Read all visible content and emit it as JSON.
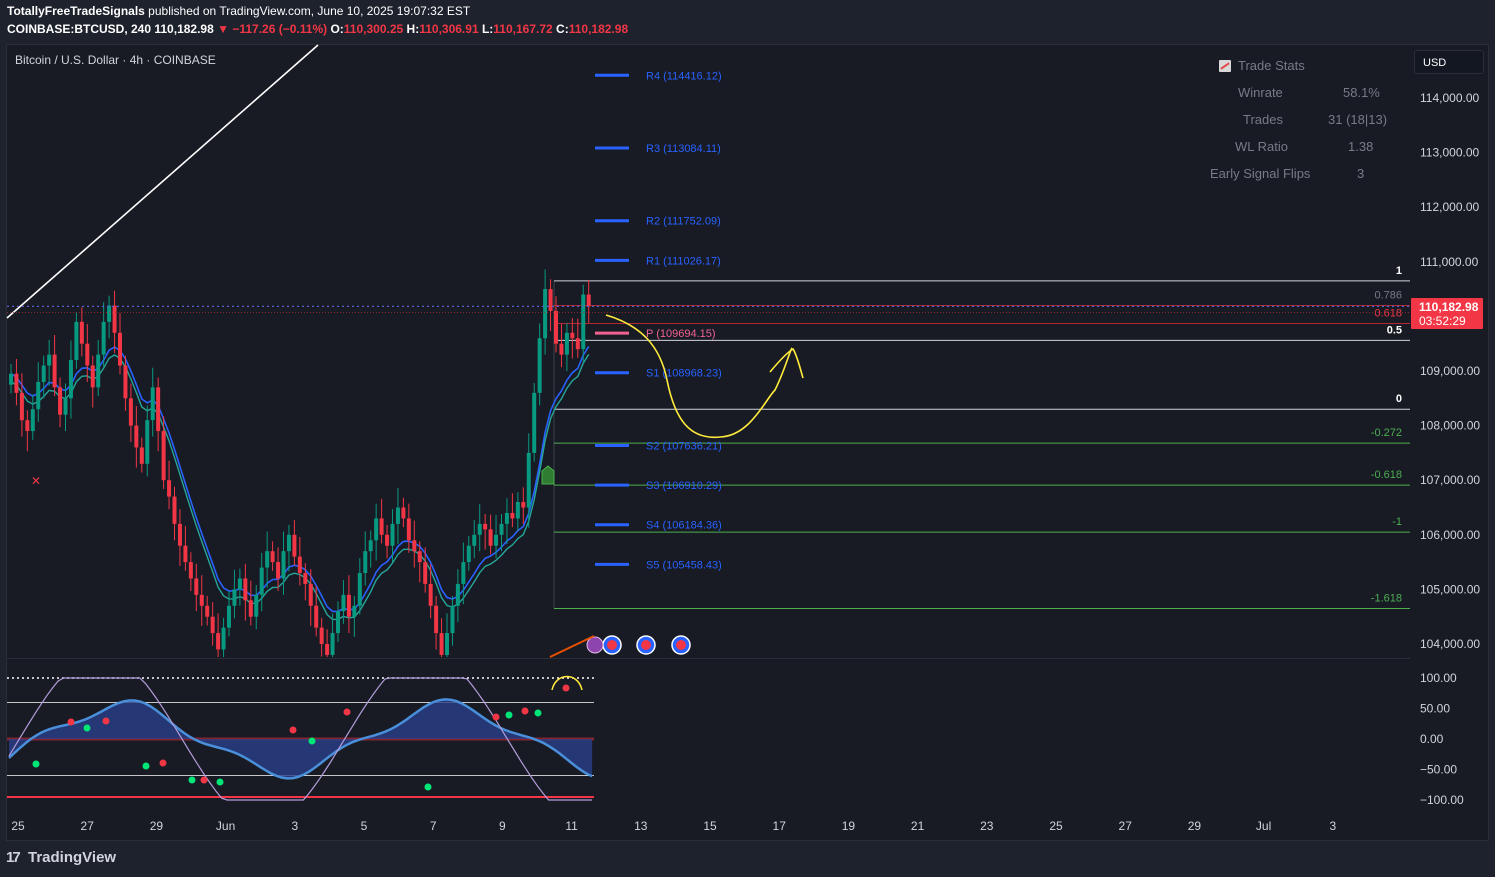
{
  "header": {
    "author": "TotallyFreeTradeSignals",
    "published_text": "published on TradingView.com, June 10, 2025 19:07:32 EST",
    "symbol_line": "COINBASE:BTCUSD, 240",
    "last": "110,182.98",
    "change_arrow": "▼",
    "change": "−117.26 (−0.11%)",
    "o_label": "O:",
    "o": "110,300.25",
    "h_label": "H:",
    "h": "110,306.91",
    "l_label": "L:",
    "l": "110,167.72",
    "c_label": "C:",
    "c": "110,182.98"
  },
  "symbol_title": "Bitcoin / U.S. Dollar · 4h · COINBASE",
  "currency_button": "USD",
  "price_tag": {
    "price": "110,182.98",
    "countdown": "03:52:29"
  },
  "trade_stats": {
    "title": "Trade Stats",
    "rows": [
      {
        "label": "Winrate",
        "value": "58.1%"
      },
      {
        "label": "Trades",
        "value": "31 (18|13)"
      },
      {
        "label": "WL Ratio",
        "value": "1.38"
      },
      {
        "label": "Early Signal Flips",
        "value": "3"
      }
    ]
  },
  "footer": {
    "logo_text": "TradingView",
    "logo_mark": "17"
  },
  "colors": {
    "background": "#181b24",
    "up": "#089981",
    "down": "#f23645",
    "pivot_blue": "#2962ff",
    "pivot_pink": "#f06292",
    "fib_green": "#4caf50",
    "annotation_yellow": "#ffeb3b",
    "ema_blue": "#2962ff",
    "ema_red": "#b22833",
    "ema_teal": "#26a69a"
  },
  "chart_data": [
    {
      "type": "candlestick",
      "title": "Bitcoin / U.S. Dollar · 4h · COINBASE",
      "xlabel": "",
      "ylabel": "",
      "ylim": [
        103700,
        114900
      ],
      "x_ticks": [
        "25",
        "27",
        "29",
        "Jun",
        "3",
        "5",
        "7",
        "9",
        "11",
        "13",
        "15",
        "17",
        "19",
        "21",
        "23",
        "25",
        "27",
        "29",
        "Jul",
        "3"
      ],
      "y_ticks": [
        "114,000.00",
        "113,000.00",
        "112,000.00",
        "111,000.00",
        "109,000.00",
        "108,000.00",
        "107,000.00",
        "106,000.00",
        "105,000.00",
        "104,000.00"
      ],
      "candles_close": [
        108950,
        108600,
        108100,
        107900,
        108300,
        108800,
        109100,
        109300,
        108700,
        108200,
        108500,
        109200,
        109900,
        109500,
        109100,
        108700,
        109300,
        109900,
        110200,
        109700,
        109100,
        108500,
        108000,
        107600,
        107300,
        108100,
        108700,
        107900,
        107000,
        106700,
        106200,
        105800,
        105500,
        105200,
        104900,
        104700,
        104500,
        104200,
        103900,
        104300,
        104700,
        105000,
        105200,
        104800,
        104500,
        104900,
        105400,
        105700,
        105500,
        105200,
        105700,
        106000,
        105600,
        105300,
        105100,
        104700,
        104300,
        104000,
        103800,
        104200,
        104600,
        104900,
        104500,
        104700,
        105300,
        105700,
        105900,
        106300,
        106000,
        105800,
        106200,
        106500,
        106300,
        105900,
        105700,
        105500,
        105100,
        104700,
        104200,
        103800,
        104200,
        104700,
        105100,
        105500,
        105800,
        106000,
        106200,
        106100,
        105800,
        106000,
        106200,
        106400,
        106300,
        106600,
        106500,
        107500,
        108600,
        109600,
        110500,
        110100,
        109500,
        109300,
        109700,
        109600,
        109400,
        110400,
        110182.98
      ],
      "ema_fast_color": "#2962ff",
      "ema_slow_color": "#b22833",
      "pivots": [
        {
          "label": "R4",
          "value": 114416.12
        },
        {
          "label": "R3",
          "value": 113084.11
        },
        {
          "label": "R2",
          "value": 111752.09
        },
        {
          "label": "R1",
          "value": 111026.17
        },
        {
          "label": "P",
          "value": 109694.15
        },
        {
          "label": "S1",
          "value": 108968.23
        },
        {
          "label": "S2",
          "value": 107636.21
        },
        {
          "label": "S3",
          "value": 106910.29
        },
        {
          "label": "S4",
          "value": 106184.36
        },
        {
          "label": "S5",
          "value": 105458.43
        }
      ],
      "fib_levels": [
        {
          "label": "1",
          "value": 110650
        },
        {
          "label": "0.786",
          "value": 110200
        },
        {
          "label": "0.618",
          "value": 109870
        },
        {
          "label": "0.5",
          "value": 109560
        },
        {
          "label": "0",
          "value": 108300
        },
        {
          "label": "-0.272",
          "value": 107680
        },
        {
          "label": "-0.618",
          "value": 106910
        },
        {
          "label": "-1",
          "value": 106050
        },
        {
          "label": "-1.618",
          "value": 104650
        }
      ],
      "current_price": 110182.98
    },
    {
      "type": "line",
      "title": "",
      "ylim": [
        -100,
        100
      ],
      "y_ticks": [
        "100.00",
        "50.00",
        "0.00",
        "−50.00",
        "−100.00"
      ],
      "bands": [
        100,
        60,
        -60
      ]
    }
  ]
}
